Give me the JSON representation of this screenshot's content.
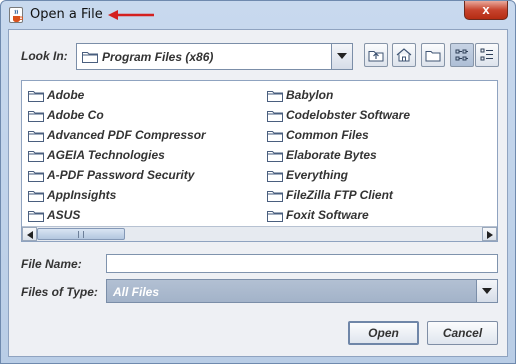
{
  "window": {
    "title": "Open a File",
    "close_label": "x"
  },
  "look_in": {
    "label": "Look In:",
    "value": "Program Files (x86)"
  },
  "toolbar": {
    "buttons": [
      {
        "name": "up-one-level",
        "icon": "folder-up-icon"
      },
      {
        "name": "home",
        "icon": "home-icon"
      },
      {
        "name": "create-new-folder",
        "icon": "new-folder-icon"
      },
      {
        "name": "list-view",
        "icon": "list-view-icon",
        "selected": true
      },
      {
        "name": "details-view",
        "icon": "details-view-icon",
        "selected": false
      }
    ]
  },
  "file_list": {
    "column_1": [
      {
        "label": "Adobe"
      },
      {
        "label": "Adobe Co"
      },
      {
        "label": "Advanced PDF Compressor"
      },
      {
        "label": "AGEIA Technologies"
      },
      {
        "label": "A-PDF Password Security"
      },
      {
        "label": "AppInsights"
      },
      {
        "label": "ASUS"
      }
    ],
    "column_2": [
      {
        "label": "Babylon"
      },
      {
        "label": "Codelobster Software"
      },
      {
        "label": "Common Files"
      },
      {
        "label": "Elaborate Bytes"
      },
      {
        "label": "Everything"
      },
      {
        "label": "FileZilla FTP Client"
      },
      {
        "label": "Foxit Software"
      }
    ]
  },
  "file_name": {
    "label": "File Name:",
    "value": ""
  },
  "files_of_type": {
    "label": "Files of Type:",
    "value": "All Files"
  },
  "buttons": {
    "open": "Open",
    "cancel": "Cancel"
  },
  "colors": {
    "annotation_arrow": "#d42020",
    "selection": "#a7b6cb"
  }
}
